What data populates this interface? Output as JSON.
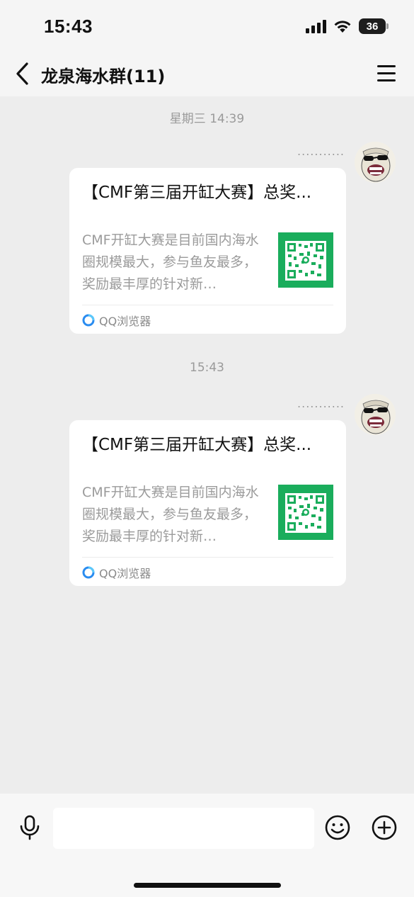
{
  "status_bar": {
    "time": "15:43",
    "battery": "36"
  },
  "nav": {
    "title": "龙泉海水群(11)"
  },
  "messages": [
    {
      "timestamp": "星期三 14:39",
      "sender": "...........",
      "card": {
        "title": "【CMF第三届开缸大赛】总奖...",
        "description": "CMF开缸大赛是目前国内海水圈规模最大，参与鱼友最多，奖励最丰厚的针对新…",
        "source": "QQ浏览器"
      }
    },
    {
      "timestamp": "15:43",
      "sender": "...........",
      "card": {
        "title": "【CMF第三届开缸大赛】总奖...",
        "description": "CMF开缸大赛是目前国内海水圈规模最大，参与鱼友最多，奖励最丰厚的针对新…",
        "source": "QQ浏览器"
      }
    }
  ],
  "input": {
    "placeholder": ""
  },
  "icons": {
    "back": "back-chevron-icon",
    "menu": "hamburger-menu-icon",
    "mic": "microphone-icon",
    "emoji": "emoji-smile-icon",
    "plus": "plus-circle-icon",
    "source": "qq-browser-icon"
  },
  "colors": {
    "thumbnail": "#1aad5c",
    "background": "#ededed"
  }
}
